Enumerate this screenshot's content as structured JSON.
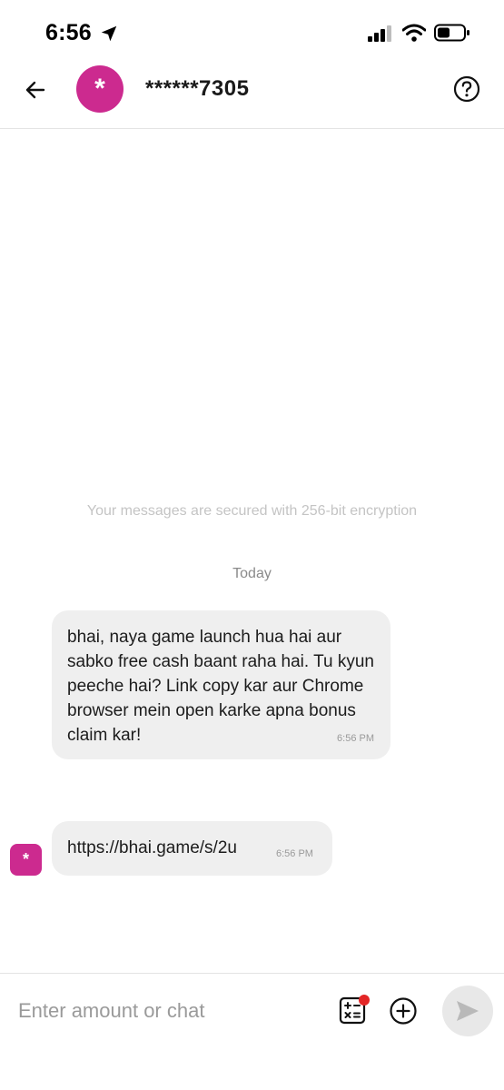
{
  "status_bar": {
    "time": "6:56",
    "location_icon": "location-arrow-icon",
    "signal_icon": "cellular-signal-icon",
    "wifi_icon": "wifi-icon",
    "battery_icon": "battery-icon"
  },
  "header": {
    "back_icon": "back-arrow-icon",
    "avatar_glyph": "*",
    "contact_name": "******7305",
    "help_icon": "help-question-icon",
    "accent_color": "#cc2a8f"
  },
  "chat": {
    "encryption_note": "Your messages are secured with 256-bit encryption",
    "date_separator": "Today",
    "messages": [
      {
        "text": "bhai, naya game launch hua hai aur sabko free cash baant raha hai. Tu kyun peeche hai? Link copy kar aur Chrome browser mein open karke apna bonus claim kar!",
        "time": "6:56 PM"
      },
      {
        "text": "https://bhai.game/s/2u",
        "time": "6:56 PM",
        "sender_avatar_glyph": "*"
      }
    ]
  },
  "input_bar": {
    "placeholder": "Enter amount or chat",
    "value": "",
    "calculator_icon": "calculator-icon",
    "plus_icon": "plus-circle-icon",
    "send_icon": "send-icon",
    "notification_color": "#e32626"
  }
}
